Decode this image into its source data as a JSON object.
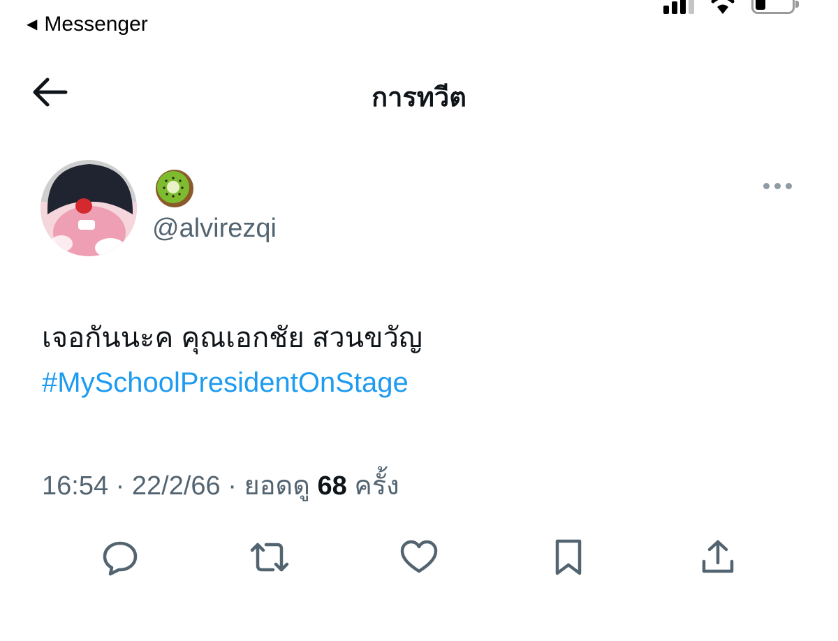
{
  "status_bar": {
    "back_app_label": "Messenger"
  },
  "header": {
    "title": "การทวีต"
  },
  "tweet": {
    "display_name_emoji": "🥝",
    "handle": "@alvirezqi",
    "text": "เจอกันนะค คุณเอกชัย สวนขวัญ",
    "hashtag": "#MySchoolPresidentOnStage",
    "time": "16:54",
    "date": "22/2/66",
    "views_label": "ยอดดู",
    "views_count": "68",
    "views_unit": "ครั้ง",
    "separator": "·"
  },
  "actions": [
    {
      "name": "reply",
      "icon": "reply-icon"
    },
    {
      "name": "retweet",
      "icon": "retweet-icon"
    },
    {
      "name": "like",
      "icon": "heart-icon"
    },
    {
      "name": "bookmark",
      "icon": "bookmark-icon"
    },
    {
      "name": "share",
      "icon": "share-icon"
    }
  ],
  "colors": {
    "link": "#1d9bf0",
    "secondary_text": "#536471",
    "icon": "#536471"
  }
}
